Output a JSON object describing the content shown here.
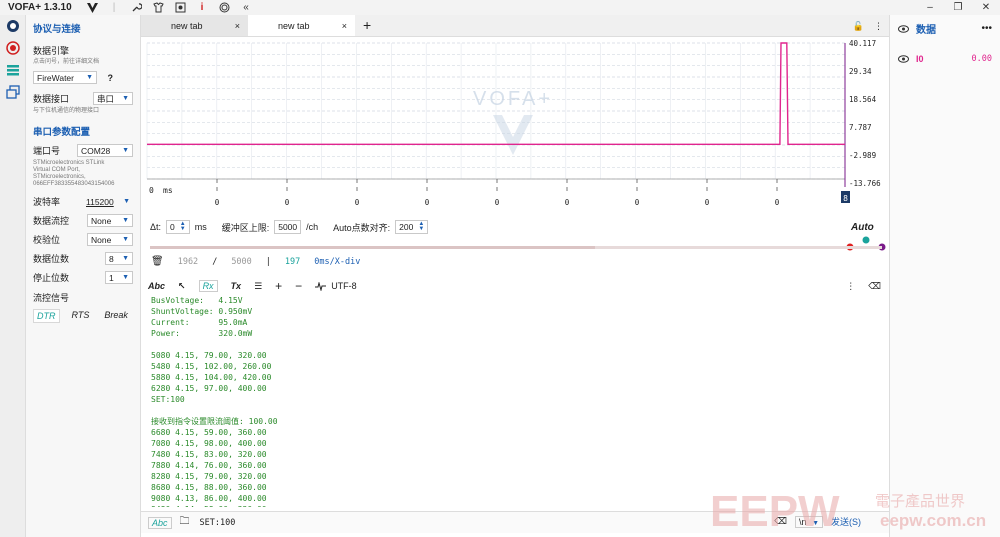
{
  "app": {
    "title": "VOFA+ 1.3.10"
  },
  "config": {
    "protocol_title": "协议与连接",
    "engine_label": "数据引擎",
    "engine_hint": "点击问号，前往详细文档",
    "engine_value": "FireWater",
    "engine_help": "?",
    "interface_label": "数据接口",
    "interface_value": "串口",
    "interface_hint": "与下位机通信的物理接口",
    "serial_title": "串口参数配置",
    "port_label": "端口号",
    "port_value": "COM28",
    "port_desc": [
      "STMicroelectronics STLink",
      "Virtual COM Port,",
      "STMicroelectronics,",
      "066EFF383355483043154006"
    ],
    "baud_label": "波特率",
    "baud_value": "115200",
    "flowctl_label": "数据流控",
    "flowctl_value": "None",
    "parity_label": "校验位",
    "parity_value": "None",
    "databits_label": "数据位数",
    "databits_value": "8",
    "stopbits_label": "停止位数",
    "stopbits_value": "1",
    "signals_label": "流控信号",
    "signals": [
      "DTR",
      "RTS",
      "Break"
    ]
  },
  "tabs": [
    {
      "label": "new tab",
      "close": "×"
    },
    {
      "label": "new tab",
      "close": "×"
    }
  ],
  "tab_add": "+",
  "chart_data": {
    "type": "line",
    "series": [
      {
        "color": "#e0258e",
        "x": [
          0,
          1,
          2,
          3,
          4,
          5,
          5.44,
          5.45,
          5.5,
          5.51,
          6
        ],
        "values": [
          0,
          0,
          0,
          0,
          0,
          0,
          0,
          40.117,
          40.117,
          0,
          0
        ]
      }
    ],
    "x_unit": "ms",
    "x_start_label": "0",
    "x_tick_labels": [
      "0",
      "0",
      "0",
      "0",
      "0",
      "0",
      "0",
      "0",
      "0"
    ],
    "y_tick_labels": [
      "40.117",
      "29.34",
      "18.564",
      "7.787",
      "-2.989",
      "-13.766"
    ],
    "ylim": [
      -13.766,
      40.117
    ],
    "cursor_label": "8",
    "watermark": "VOFA+",
    "grid": true
  },
  "controls": {
    "dt_label": "Δt:",
    "dt_value": "0",
    "dt_unit": "ms",
    "buffer_label": "缓冲区上限:",
    "buffer_value": "5000",
    "buffer_unit": "/ch",
    "align_label": "Auto点数对齐:",
    "align_value": "200",
    "auto_label": "Auto"
  },
  "stats": {
    "current": "1962",
    "separator": "/",
    "total": "5000",
    "bar": "|",
    "count": "197",
    "xdiv": "0ms/X-div"
  },
  "term_toolbar": {
    "abc": "Abc",
    "rx": "Rx",
    "tx": "Tx",
    "encoding": "UTF-8"
  },
  "terminal": {
    "lines": [
      "BusVoltage:   4.15V",
      "ShuntVoltage: 0.950mV",
      "Current:      95.0mA",
      "Power:        320.0mW",
      "",
      "5080 4.15, 79.00, 320.00",
      "5480 4.15, 102.00, 260.00",
      "5880 4.15, 104.00, 420.00",
      "6280 4.15, 97.00, 400.00",
      "SET:100",
      "",
      "接收到指令设置限流阈值: 100.00",
      "6680 4.15, 59.00, 360.00",
      "7080 4.15, 98.00, 400.00",
      "7480 4.15, 83.00, 320.00",
      "7880 4.14, 76.00, 360.00",
      "8280 4.15, 79.00, 320.00",
      "8680 4.15, 88.00, 360.00",
      "9080 4.13, 86.00, 400.00",
      "9480 4.14, 58.00, 220.00"
    ]
  },
  "send_bar": {
    "mode": "Abc",
    "input": "SET:100",
    "newline": "\\n",
    "send_label": "发送(S)"
  },
  "data_panel": {
    "title": "数据",
    "more": "•••",
    "channel_name": "I0",
    "channel_value": "0.00"
  },
  "watermark": {
    "brand": "EEPW",
    "cn": "電子產品世界",
    "url": "eepw.com.cn"
  },
  "colors": {
    "accent": "#1c5fb2",
    "teal": "#1ba39c",
    "series": "#e0258e",
    "terminal_text": "#2a8a2a"
  }
}
